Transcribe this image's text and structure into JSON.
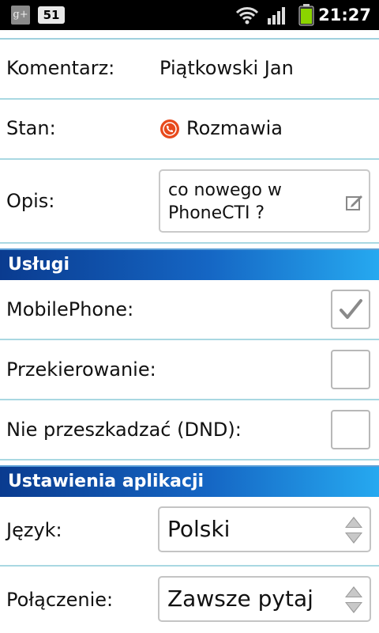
{
  "statusbar": {
    "gplus": "g+",
    "notification_count": "51",
    "time": "21:27"
  },
  "contact": {
    "comment_label": "Komentarz:",
    "comment_value": "Piątkowski Jan",
    "state_label": "Stan:",
    "state_value": "Rozmawia",
    "description_label": "Opis:",
    "description_value": "co nowego w PhoneCTI ?"
  },
  "services": {
    "header": "Usługi",
    "mobile_label": "MobilePhone:",
    "mobile_checked": true,
    "forward_label": "Przekierowanie:",
    "forward_checked": false,
    "dnd_label": "Nie przeszkadzać (DND):",
    "dnd_checked": false
  },
  "app_settings": {
    "header": "Ustawienia aplikacji",
    "language_label": "Język:",
    "language_value": "Polski",
    "connection_label": "Połączenie:",
    "connection_value": "Zawsze pytaj"
  },
  "colors": {
    "separator": "#a9d8e2",
    "section_gradient_start": "#0a3b8f",
    "section_gradient_end": "#26a9f0",
    "status_icon": "#e84a1c",
    "battery": "#8bd400"
  },
  "icons": {
    "gplus": "google-plus-icon",
    "wifi": "wifi-icon",
    "signal": "signal-icon",
    "battery": "battery-icon",
    "status": "talking-status-icon",
    "edit": "edit-icon",
    "check": "checkmark-icon",
    "select_arrows": "spinner-arrows-icon"
  }
}
